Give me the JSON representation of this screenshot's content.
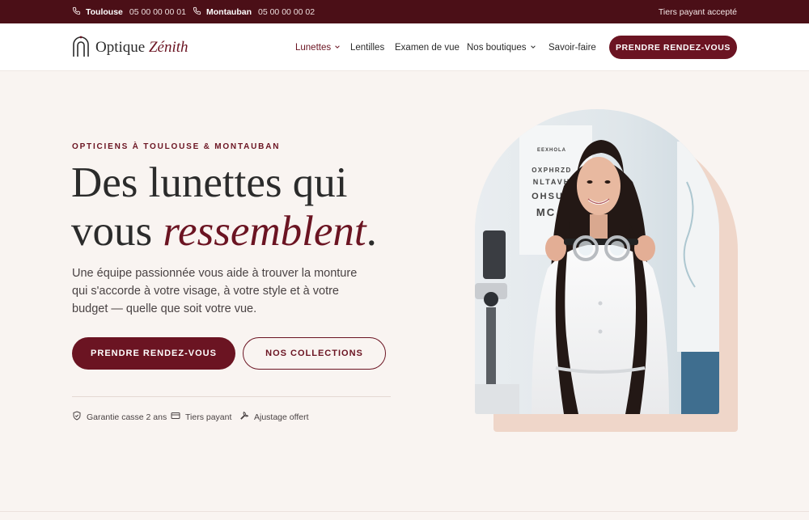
{
  "topbar": {
    "locations": [
      {
        "city": "Toulouse",
        "phone": "05 00 00 00 01"
      },
      {
        "city": "Montauban",
        "phone": "05 00 00 00 02"
      }
    ],
    "notice": "Tiers payant accepté"
  },
  "header": {
    "logo": {
      "word1": "Optique",
      "word2": "Zénith"
    },
    "nav": [
      {
        "label": "Lunettes",
        "has_dropdown": true,
        "active": true
      },
      {
        "label": "Lentilles",
        "has_dropdown": false
      },
      {
        "label": "Examen de vue",
        "has_dropdown": false
      },
      {
        "label": "Nos boutiques",
        "has_dropdown": true
      },
      {
        "label": "Savoir-faire",
        "has_dropdown": false
      }
    ],
    "cta": "PRENDRE RENDEZ-VOUS"
  },
  "hero": {
    "eyebrow": "OPTICIENS À TOULOUSE & MONTAUBAN",
    "title_line1": "Des lunettes qui",
    "title_line2_plain": "vous ",
    "title_line2_accent": "ressemblent",
    "title_line2_end": ".",
    "lead": "Une équipe passionnée vous aide à trouver la monture qui s'accorde à votre visage, à votre style et à votre budget — quelle que soit votre vue.",
    "primary_button": "PRENDRE RENDEZ-VOUS",
    "secondary_button": "NOS COLLECTIONS",
    "features": [
      {
        "icon": "shield-icon",
        "label": "Garantie casse 2 ans"
      },
      {
        "icon": "card-icon",
        "label": "Tiers payant"
      },
      {
        "icon": "wrench-icon",
        "label": "Ajustage offert"
      }
    ],
    "photo_chart_lines": [
      "EEXHOLA",
      "OXPHRZD",
      "NLTAVH",
      "OHSU",
      "MC"
    ]
  },
  "colors": {
    "brand": "#6b1422",
    "topbar_bg": "#4b0f17",
    "page_bg": "#f9f4f1",
    "photo_accent": "#efd6c9"
  }
}
